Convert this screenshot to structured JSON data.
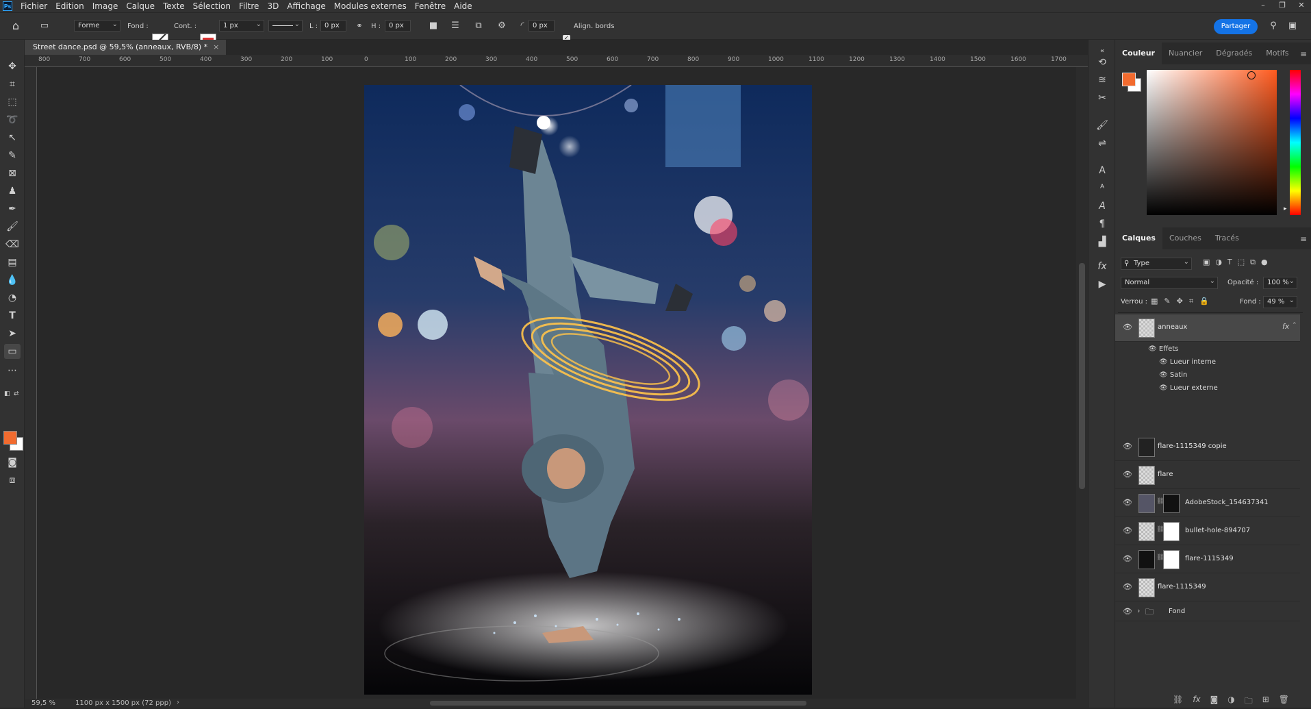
{
  "menu": {
    "app_icon": "Ps",
    "items": [
      "Fichier",
      "Edition",
      "Image",
      "Calque",
      "Texte",
      "Sélection",
      "Filtre",
      "3D",
      "Affichage",
      "Modules externes",
      "Fenêtre",
      "Aide"
    ]
  },
  "options_bar": {
    "mode": "Forme",
    "fill_label": "Fond :",
    "stroke_label": "Cont. :",
    "stroke_width": "1 px",
    "w_label": "L :",
    "w_value": "0 px",
    "h_label": "H :",
    "h_value": "0 px",
    "radius_value": "0 px",
    "align_edges_label": "Align. bords",
    "share_label": "Partager"
  },
  "document": {
    "tab_title": "Street dance.psd @ 59,5% (anneaux, RVB/8) *",
    "zoom": "59,5 %",
    "doc_size": "1100 px x 1500 px (72 ppp)"
  },
  "ruler_labels": [
    "800",
    "700",
    "600",
    "500",
    "400",
    "300",
    "200",
    "100",
    "0",
    "100",
    "200",
    "300",
    "400",
    "500",
    "600",
    "700",
    "800",
    "900",
    "1000",
    "1100",
    "1200",
    "1300",
    "1400",
    "1500",
    "1600",
    "1700"
  ],
  "color_panel": {
    "tabs": [
      "Couleur",
      "Nuancier",
      "Dégradés",
      "Motifs"
    ],
    "foreground": "#f26b2f",
    "background": "#ffffff",
    "hue_color": "#ff5a1e"
  },
  "layers_panel": {
    "tabs": [
      "Calques",
      "Couches",
      "Tracés"
    ],
    "filter_type": "Type",
    "blend_mode": "Normal",
    "opacity_label": "Opacité :",
    "opacity_value": "100 %",
    "lock_label": "Verrou :",
    "fill_label": "Fond :",
    "fill_value": "49 %",
    "fx_badge": "fx",
    "layers": [
      {
        "name": "anneaux"
      },
      {
        "name": "flare-1115349 copie"
      },
      {
        "name": "flare"
      },
      {
        "name": "AdobeStock_154637341"
      },
      {
        "name": "bullet-hole-894707"
      },
      {
        "name": "flare-1115349"
      },
      {
        "name": "flare-1115349"
      },
      {
        "name": "Fond"
      }
    ],
    "effects_header": "Effets",
    "effects": [
      "Lueur interne",
      "Satin",
      "Lueur externe"
    ]
  }
}
